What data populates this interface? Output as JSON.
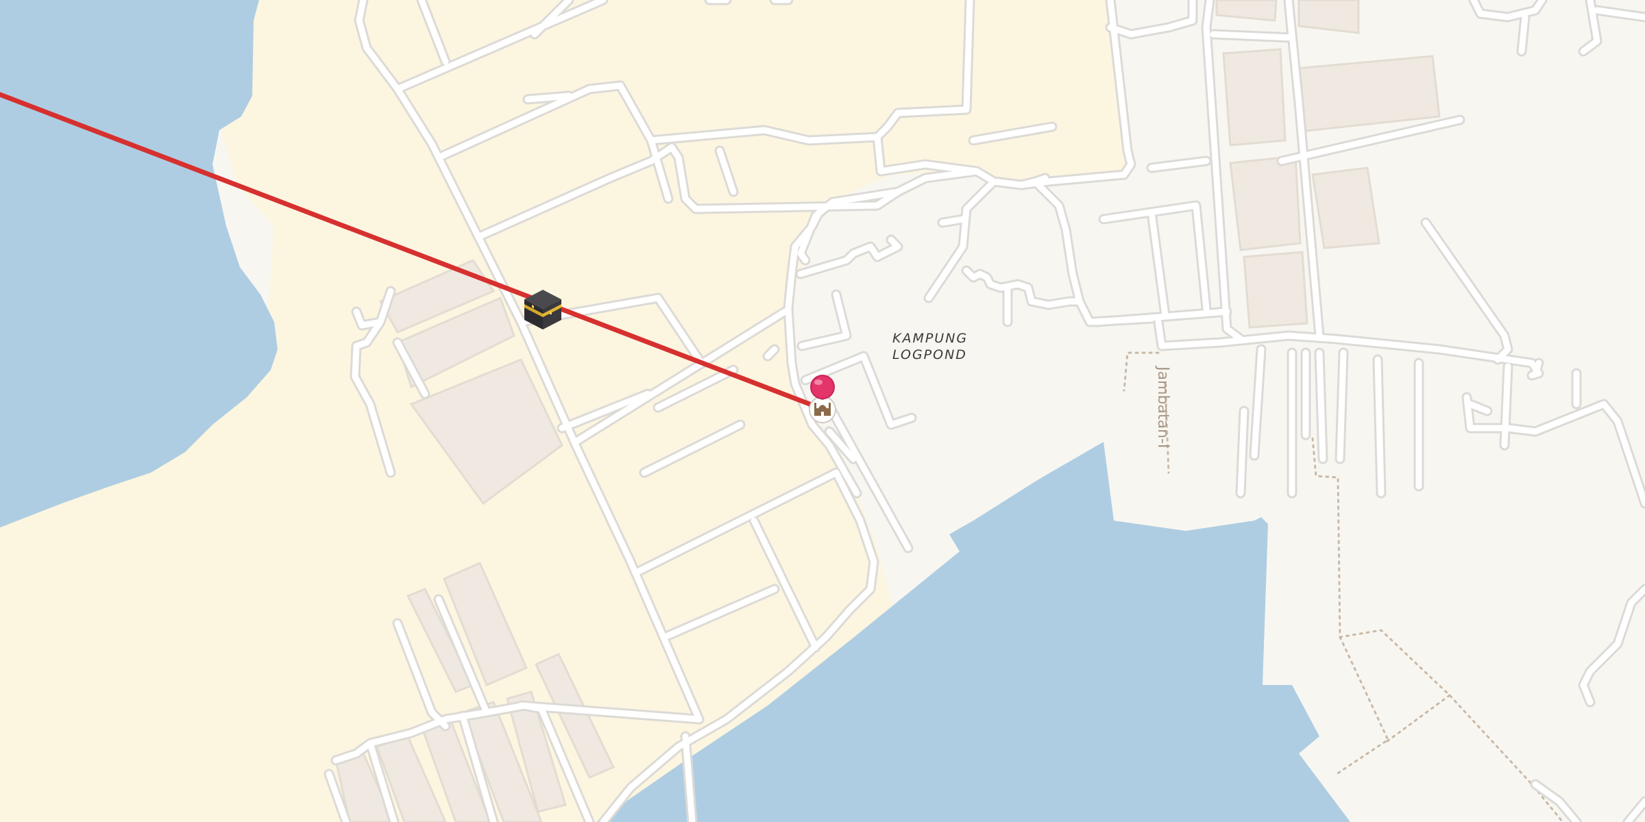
{
  "map": {
    "colors": {
      "water": "#aecde2",
      "land": "#f8f6f1",
      "residential": "#fcf5e0",
      "route_line": "#d6302f",
      "pin": "#e3356a"
    },
    "place_labels": {
      "line1": "KAMPUNG",
      "line2": "LOGPOND"
    },
    "street_labels": {
      "jambatan": "Jambatan-I"
    },
    "markers": {
      "kaaba": {
        "icon": "kaaba-icon",
        "glyph": "🕋"
      },
      "mosque": {
        "icon": "mosque-icon",
        "glyph": "🕌"
      },
      "location_pin": {
        "icon": "location-pin-icon"
      }
    },
    "route": {
      "description_icon": "qibla-direction-line"
    }
  }
}
